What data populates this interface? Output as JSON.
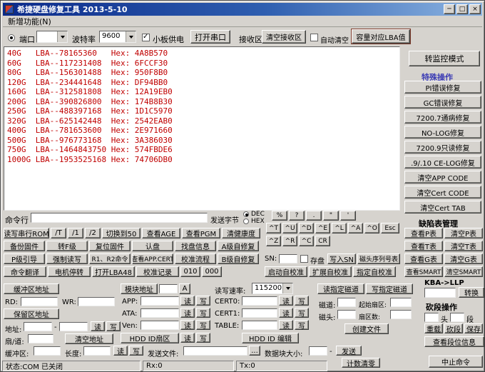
{
  "window": {
    "title": "希捷硬盘修复工具 2013-5-10",
    "menu_item": "新增功能(N)",
    "minimize": "─",
    "maximize": "□",
    "close": "×"
  },
  "toolbar": {
    "port_label": "端口",
    "baud_label": "波特率",
    "baud_value": "9600",
    "board_power_label": "小板供电",
    "open_serial": "打开串口",
    "receive_label": "接收区",
    "clear_receive": "清空接收区",
    "auto_clear_label": "自动清空",
    "capacity_lba": "容量对应LBA值"
  },
  "receive": {
    "lines": [
      "40G   LBA--78165360   Hex: 4A8B570",
      "60G   LBA--117231408  Hex: 6FCCF30",
      "80G   LBA--156301488  Hex: 950F8B0",
      "120G  LBA--234441648  Hex: DF94BB0",
      "160G  LBA--312581808  Hex: 12A19EB0",
      "200G  LBA--390826800  Hex: 174B8B30",
      "250G  LBA--488397168  Hex: 1D1C5970",
      "320G  LBA--625142448  Hex: 2542EAB0",
      "400G  LBA--781653600  Hex: 2E971660",
      "500G  LBA--976773168  Hex: 3A386030",
      "750G  LBA--1464843750 Hex: 574FBDE6",
      "1000G LBA--1953525168 Hex: 74706DB0"
    ]
  },
  "right_panel": {
    "monitor_mode": "转监控模式",
    "special_title": "特殊操作",
    "special_buttons": [
      "PI错误修复",
      "GC错误修复",
      "7200.7通病修复",
      "NO-LOG修复",
      "7200.9只读修复",
      ".9/.10 CE-LOG修复",
      "清空APP CODE",
      "清空Cert CODE",
      "清空Cert TAB"
    ]
  },
  "command_row": {
    "label": "命令行",
    "send_bytes_label": "发送字节",
    "radio_dec": "DEC",
    "radio_hex": "HEX"
  },
  "keypad": {
    "row1": [
      "%",
      "?",
      ".",
      "\"",
      "'"
    ],
    "row2": [
      "^T",
      "^U",
      "^D",
      "^E",
      "^L",
      "^A",
      "^O",
      "Esc"
    ],
    "row3": [
      "^Z",
      "^R",
      "^C",
      "CR"
    ]
  },
  "grid": {
    "row1": [
      "读写串行ROM",
      "/T",
      "/1",
      "/2",
      "切换到50",
      "查看AGE",
      "查看PGM",
      "清健康度"
    ],
    "row2": [
      "备份固件",
      "转F级",
      "复位固件",
      "认盘",
      "找盘信息",
      "A级自修复"
    ],
    "row3": [
      "P级引导",
      "强制读写",
      "R1、R2命令",
      "查看APP.CERT",
      "校准流程",
      "B级自修复"
    ],
    "row4": [
      "命令翻译",
      "电机停转",
      "打开LBA48",
      "校准记录",
      "010",
      "000"
    ]
  },
  "sn_area": {
    "sn_label": "SN:",
    "save_label": "存盘",
    "write_sn": "写入SN",
    "head_serial_table": "磁头序列号表",
    "selfcal": [
      "启动自校准",
      "扩展自校准",
      "指定自校准"
    ]
  },
  "defect": {
    "title": "缺陷表管理",
    "buttons": [
      [
        "查看P表",
        "清空P表"
      ],
      [
        "查看T表",
        "清空T表"
      ],
      [
        "查看G表",
        "清空G表"
      ],
      [
        "查看SMART",
        "清空SMART"
      ]
    ]
  },
  "kba": {
    "label": "KBA->LLP",
    "convert": "转换"
  },
  "segment": {
    "title": "砍段操作",
    "head_label": "头",
    "seg_label": "段",
    "reload": "重载",
    "cut": "砍段",
    "save": "保存",
    "view_info": "查看段位信息"
  },
  "address_panel": {
    "buffer_addr": "缓冲区地址",
    "rd": "RD:",
    "wr": "WR:",
    "reserved_addr": "保留区地址",
    "addr": "地址:",
    "sector": "扇/道:",
    "clear_addr": "清空地址"
  },
  "module_panel": {
    "module_addr": "模块地址",
    "a_button": "A",
    "speed_label": "读写速率:",
    "speed_value": "115200",
    "app": "APP:",
    "ata": "ATA:",
    "ven": "Ven:",
    "hdd_id_sector": "HDD ID扇区",
    "cert0": "CERT0:",
    "cert1": "CERT1:",
    "table": "TABLE:",
    "hdd_id_edit": "HDD ID 编辑"
  },
  "track_panel": {
    "read_track": "读指定磁道",
    "write_track": "写指定磁道",
    "track": "磁道:",
    "start_sector": "起始扇区:",
    "head": "磁头:",
    "sector_count": "扇区数:",
    "create_file": "创建文件"
  },
  "bottom_row": {
    "buffer": "缓冲区:",
    "length": "长度:",
    "send_file": "发送文件:",
    "browse": "...",
    "block_size": "数据块大小:",
    "send": "发送",
    "counter_reset": "计数清零"
  },
  "status_bar": {
    "status": "状态:COM 已关闭",
    "rx": "Rx:0",
    "tx": "Tx:0",
    "abort": "中止命令"
  },
  "common": {
    "read": "读",
    "write": "写",
    "dash": "-"
  }
}
